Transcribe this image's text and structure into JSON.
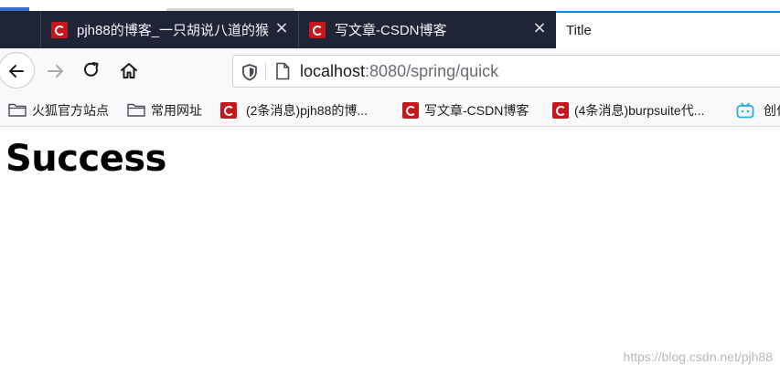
{
  "tabs": [
    {
      "title": "pjh88的博客_一只胡说八道的猴",
      "favicon": "csdn-icon",
      "state": "inactive"
    },
    {
      "title": "写文章-CSDN博客",
      "favicon": "csdn-icon",
      "state": "inactive"
    },
    {
      "title": "Title",
      "state": "active"
    }
  ],
  "toolbar": {
    "back": "back-arrow-icon",
    "forward": "forward-arrow-icon",
    "reload": "reload-icon",
    "home": "home-icon"
  },
  "urlbar": {
    "host": "localhost",
    "path": ":8080/spring/quick"
  },
  "bookmarks": [
    {
      "label": "火狐官方站点",
      "icon": "folder-icon"
    },
    {
      "label": "常用网址",
      "icon": "folder-icon"
    },
    {
      "label": "(2条消息)pjh88的博...",
      "icon": "csdn-icon"
    },
    {
      "label": "写文章-CSDN博客",
      "icon": "csdn-icon"
    },
    {
      "label": "(4条消息)burpsuite代...",
      "icon": "csdn-icon"
    },
    {
      "label": "创作",
      "icon": "bilibili-icon"
    }
  ],
  "page": {
    "heading": "Success"
  },
  "watermark": "https://blog.csdn.net/pjh88",
  "colors": {
    "tabstrip": "#1f2536",
    "active_tab_accent": "#0a84ff",
    "csdn_red": "#c8161d"
  }
}
